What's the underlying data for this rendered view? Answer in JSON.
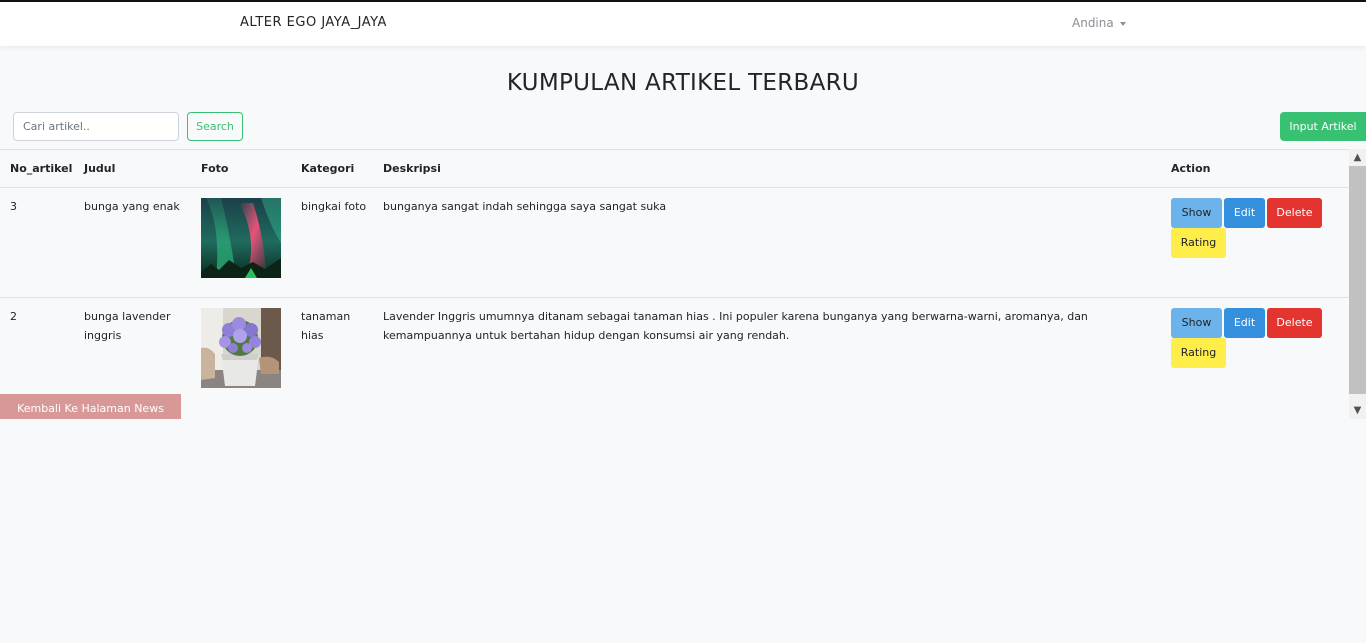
{
  "navbar": {
    "brand": "ALTER EGO JAYA_JAYA",
    "user": "Andina"
  },
  "page": {
    "title": "KUMPULAN ARTIKEL TERBARU"
  },
  "search": {
    "placeholder": "Cari artikel..",
    "button_label": "Search"
  },
  "toolbar": {
    "input_label": "Input Artikel"
  },
  "table": {
    "headers": [
      "No_artikel",
      "Judul",
      "Foto",
      "Kategori",
      "Deskripsi",
      "Action"
    ],
    "rows": [
      {
        "no": "3",
        "judul": "bunga yang enak",
        "foto": "aurora-photo",
        "kategori": "bingkai foto",
        "deskripsi": "bunganya sangat indah sehingga saya sangat suka"
      },
      {
        "no": "2",
        "judul": "bunga lavender inggris",
        "foto": "lavender-pot-photo",
        "kategori": "tanaman hias",
        "deskripsi": "Lavender Inggris umumnya ditanam sebagai tanaman hias . Ini populer karena bunganya yang berwarna-warni, aromanya, dan kemampuannya untuk bertahan hidup dengan konsumsi air yang rendah."
      }
    ],
    "actions": {
      "show": "Show",
      "edit": "Edit",
      "delete": "Delete",
      "rating": "Rating"
    }
  },
  "footer": {
    "back_label": "Kembali Ke Halaman News"
  },
  "colors": {
    "success": "#38c172",
    "info": "#6cb2eb",
    "primary": "#3490dc",
    "danger": "#e3342f",
    "warning": "#ffed4a",
    "back_button": "#d89898"
  }
}
